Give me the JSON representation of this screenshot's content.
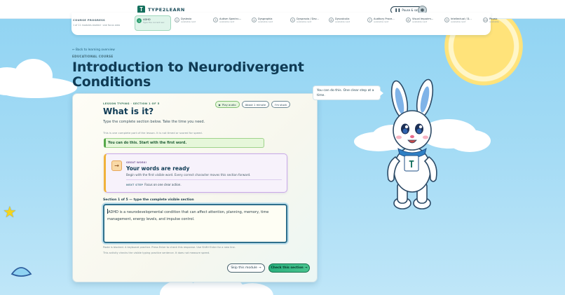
{
  "app": {
    "brand_logo_glyph": "T",
    "brand_name": "TYPE2LEARN",
    "pause_label": "Pause & save",
    "pause_icon": "pause-icon",
    "avatar_icon": "user-avatar-icon"
  },
  "progress": {
    "label": "COURSE PROGRESS",
    "sub": "1 of 11 modules started · one focus area",
    "steps": [
      {
        "num": "1",
        "title": "ADHD",
        "status": "Type the current sec",
        "active": true
      },
      {
        "num": "2",
        "title": "Dyslexia",
        "status": "available next",
        "active": false
      },
      {
        "num": "3",
        "title": "Autism Spectru...",
        "status": "available next",
        "active": false
      },
      {
        "num": "4",
        "title": "Dysgraphia",
        "status": "available next",
        "active": false
      },
      {
        "num": "5",
        "title": "Dyspraxia / Dev...",
        "status": "available next",
        "active": false
      },
      {
        "num": "6",
        "title": "Dyscalculia",
        "status": "available next",
        "active": false
      },
      {
        "num": "7",
        "title": "Auditory Proce...",
        "status": "available next",
        "active": false
      },
      {
        "num": "8",
        "title": "Visual Impairm...",
        "status": "available next",
        "active": false
      },
      {
        "num": "9",
        "title": "Intellectual / D...",
        "status": "available next",
        "active": false
      },
      {
        "num": "10",
        "title": "Physic",
        "status": "available",
        "active": false
      }
    ]
  },
  "header": {
    "back_link": "← Back to learning overview",
    "eyebrow": "EDUCATIONAL COURSE",
    "title": "Introduction to Neurodivergent Conditions"
  },
  "lesson": {
    "eyebrow": "LESSON TYPING · SECTION 1 OF 5",
    "title": "What is it?",
    "play_audio": "Play audio",
    "play_icon": "play-icon",
    "duration": "About 1 minute",
    "unsure": "I'm stuck",
    "instructions": "Type the complete section below. Take the time you need.",
    "meta_note": "This is one complete part of the lesson. It is not timed or scored for speed.",
    "encouragement": "You can do this. Start with the first word."
  },
  "feedback": {
    "icon_glyph": "→",
    "eyebrow": "GREAT WORK!",
    "title": "Your words are ready",
    "desc": "Begin with the first visible word. Every correct character moves this section forward.",
    "next_label": "NEXT STEP",
    "next_text": "Focus on one clear action."
  },
  "typing": {
    "section_label": "Section 1 of 5 — type the complete visible section",
    "text": "ADHD is a neurodevelopmental condition that can affect attention, planning, memory, time management, energy levels, and impulse control.",
    "hint": "Paste is blocked. A keyboard practice. Press Enter to check this response. Use Shift+Enter for a new line.",
    "hint2": "This activity checks the visible typing practice sentence. It does not measure speed."
  },
  "actions": {
    "skip_label": "Skip this module",
    "skip_arrow": "→",
    "check_label": "Check this section",
    "check_arrow": "→"
  },
  "mascot": {
    "bubble": "You can do this. One clear step at a time.",
    "badge_glyph": "T"
  },
  "colors": {
    "sky": "#8fd3f2",
    "accent_green": "#2bb07e",
    "title_navy": "#0f3b55",
    "sun": "#ffe37a",
    "feedback_border": "#c8a9e8",
    "star": "#f4d51c"
  }
}
